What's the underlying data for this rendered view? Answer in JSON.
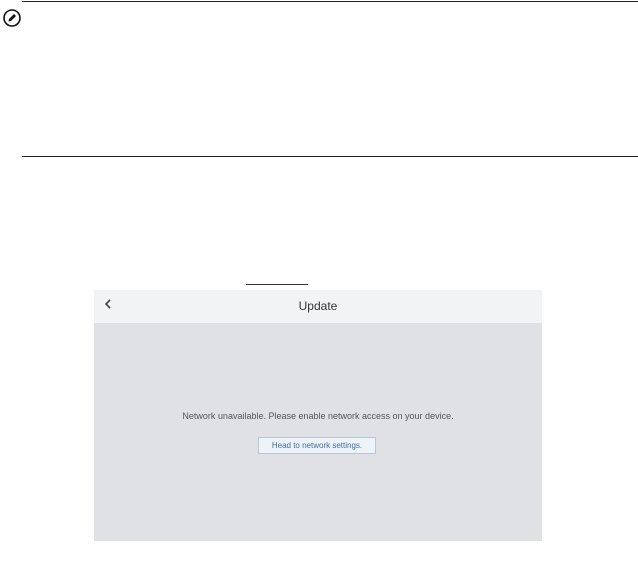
{
  "icons": {
    "note": "pencil-circle-icon",
    "back": "chevron-left-icon"
  },
  "screen": {
    "title": "Update",
    "message": "Network unavailable. Please enable network access on your device.",
    "network_button_label": "Head to network settings."
  },
  "colors": {
    "screen_bg": "#dfe1e4",
    "header_bg": "#f2f3f5",
    "button_text": "#3f6ea3",
    "button_border": "#b9c6d6"
  }
}
